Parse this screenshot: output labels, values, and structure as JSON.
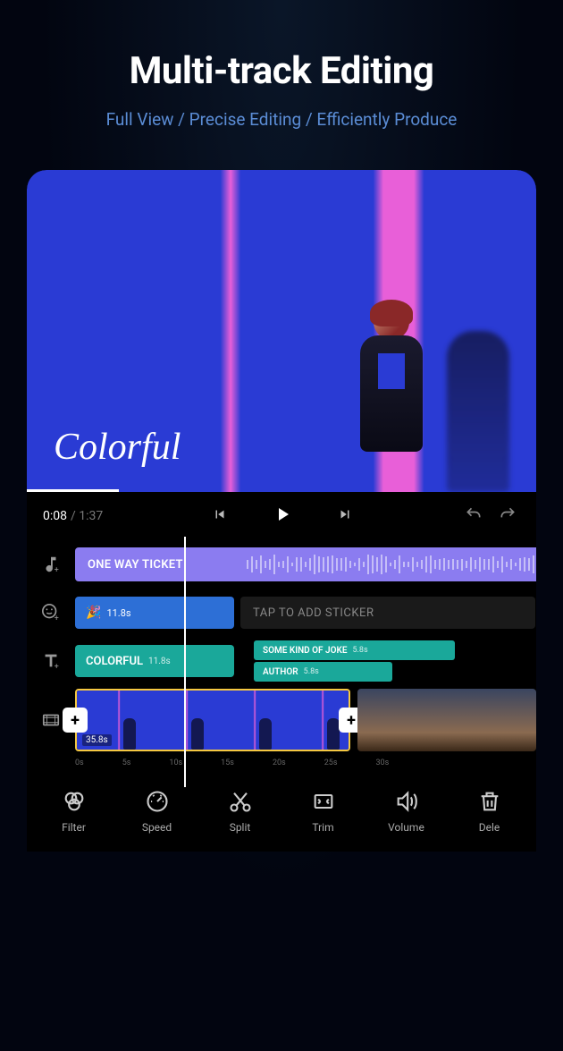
{
  "hero": {
    "title": "Multi-track Editing",
    "subtitle": "Full View / Precise Editing / Efficiently Produce"
  },
  "preview": {
    "overlay": "Colorful"
  },
  "playback": {
    "current": "0:08",
    "total": "1:37"
  },
  "tracks": {
    "audio": {
      "title": "ONE WAY TICKET"
    },
    "sticker": {
      "duration": "11.8s",
      "placeholder": "TAP TO ADD STICKER"
    },
    "text1": {
      "label": "COLORFUL",
      "duration": "11.8s"
    },
    "text2": {
      "label": "SOME KIND OF JOKE",
      "duration": "5.8s"
    },
    "text3": {
      "label": "AUTHOR",
      "duration": "5.8s"
    },
    "video": {
      "duration": "35.8s"
    }
  },
  "ruler": [
    "0s",
    "5s",
    "10s",
    "15s",
    "20s",
    "25s",
    "30s"
  ],
  "toolbar": {
    "filter": "Filter",
    "speed": "Speed",
    "split": "Split",
    "trim": "Trim",
    "volume": "Volume",
    "delete": "Dele"
  }
}
